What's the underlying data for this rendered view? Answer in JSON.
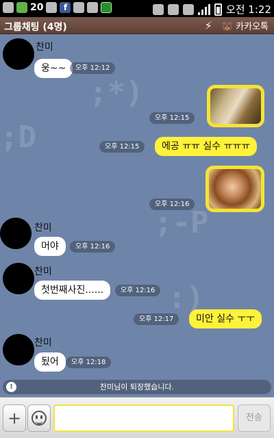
{
  "status_bar": {
    "notification_count": "20",
    "time": "오전 1:22"
  },
  "header": {
    "title": "그룹채팅 (4명)",
    "app_name": "카카오톡"
  },
  "messages": [
    {
      "type": "incoming",
      "sender": "찬미",
      "text": "웅~~",
      "time": "오후 12:12"
    },
    {
      "type": "outgoing-photo",
      "time": "오후 12:15"
    },
    {
      "type": "outgoing",
      "text": "에공 ㅠㅠ 실수 ㅠㅠㅠ",
      "time": "오후 12:15"
    },
    {
      "type": "outgoing-photo",
      "time": "오후 12:16"
    },
    {
      "type": "incoming",
      "sender": "찬미",
      "text": "머야",
      "time": "오후 12:16"
    },
    {
      "type": "incoming",
      "sender": "찬미",
      "text": "첫번째사진......",
      "time": "오후 12:16"
    },
    {
      "type": "outgoing",
      "text": "미안 실수 ㅜㅜ",
      "time": "오후 12:17"
    },
    {
      "type": "incoming",
      "sender": "찬미",
      "text": "됬어",
      "time": "오후 12:18"
    }
  ],
  "system_notice": "찬미님이 퇴장했습니다.",
  "input_bar": {
    "add_label": "+",
    "input_value": "",
    "send_label": "전송"
  },
  "colors": {
    "chat_background": "#6e85a9",
    "outgoing_bubble": "#fff23a",
    "incoming_bubble": "#ffffff",
    "header_background": "#6b4c41"
  }
}
